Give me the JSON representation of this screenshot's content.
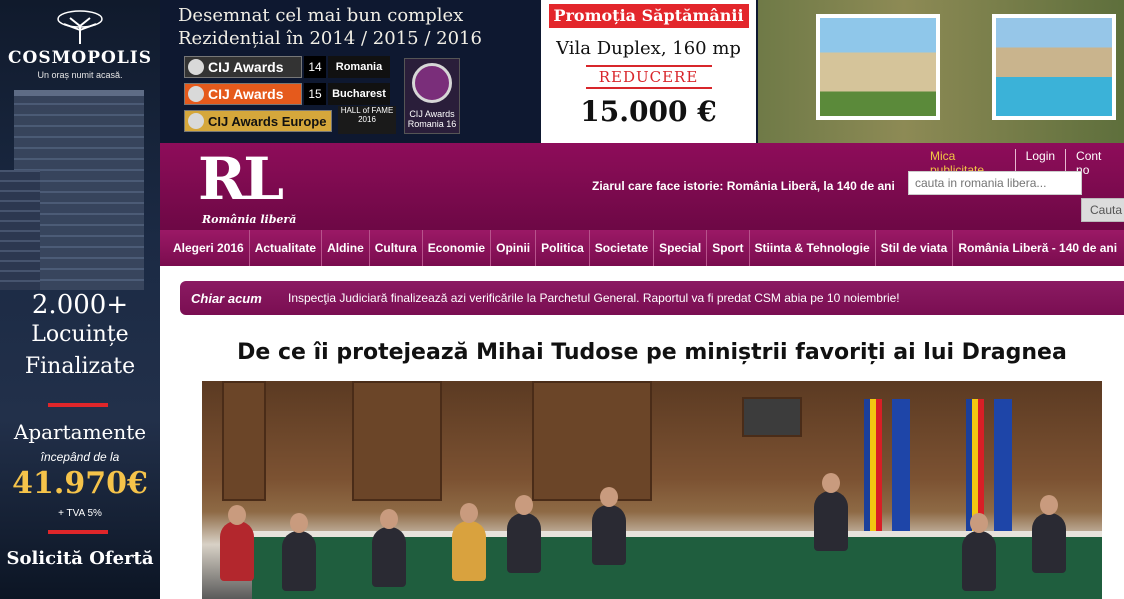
{
  "left_ad": {
    "brand": "COSMOPOLIS",
    "tagline": "Un oraș numit acasă.",
    "count": "2.000+",
    "line1": "Locuințe",
    "line2": "Finalizate",
    "apartments": "Apartamente",
    "from": "începând de la",
    "price": "41.970€",
    "tva": "+ TVA 5%",
    "cta": "Solicită Ofertă"
  },
  "top_ad": {
    "title_line1": "Desemnat cel mai bun complex",
    "title_line2": "Rezidențial în 2014 / 2015 / 2016",
    "awards": [
      {
        "label": "CIJ Awards",
        "num": "14",
        "place": "Romania"
      },
      {
        "label": "CIJ Awards",
        "num": "15",
        "place": "Bucharest"
      },
      {
        "label": "CIJ Awards Europe",
        "num": "",
        "place": ""
      }
    ],
    "hall_of_fame": "HALL of FAME 2016",
    "cij_logo": "CIJ Awards Romania 16",
    "promo_header": "Promoția Săptămânii",
    "promo_name": "Vila Duplex, 160 mp",
    "promo_discount": "REDUCERE",
    "promo_amount": "15.000 €"
  },
  "header": {
    "logo": "RL",
    "logo_sub": "România liberă",
    "tagline": "Ziarul care face istorie: România Liberă, la 140 de ani",
    "links": [
      "Mica publicitate",
      "Login",
      "Cont no"
    ],
    "search_placeholder": "cauta in romania libera...",
    "search_button": "Cauta"
  },
  "nav": {
    "items": [
      "Alegeri 2016",
      "Actualitate",
      "Aldine",
      "Cultura",
      "Economie",
      "Opinii",
      "Politica",
      "Societate",
      "Special",
      "Sport",
      "Stiinta & Tehnologie",
      "Stil de viata",
      "România Liberă - 140 de ani"
    ]
  },
  "breaking": {
    "label": "Chiar acum",
    "text": "Inspecţia Judiciară finalizează azi verificările la Parchetul General. Raportul va fi predat CSM abia pe 10 noiembrie!"
  },
  "article": {
    "headline": "De ce îi protejează Mihai Tudose pe miniștrii favoriți ai lui Dragnea"
  },
  "colors": {
    "brand": "#7a0c4e",
    "promo_red": "#e3262b",
    "link_highlight": "#f2c744"
  }
}
